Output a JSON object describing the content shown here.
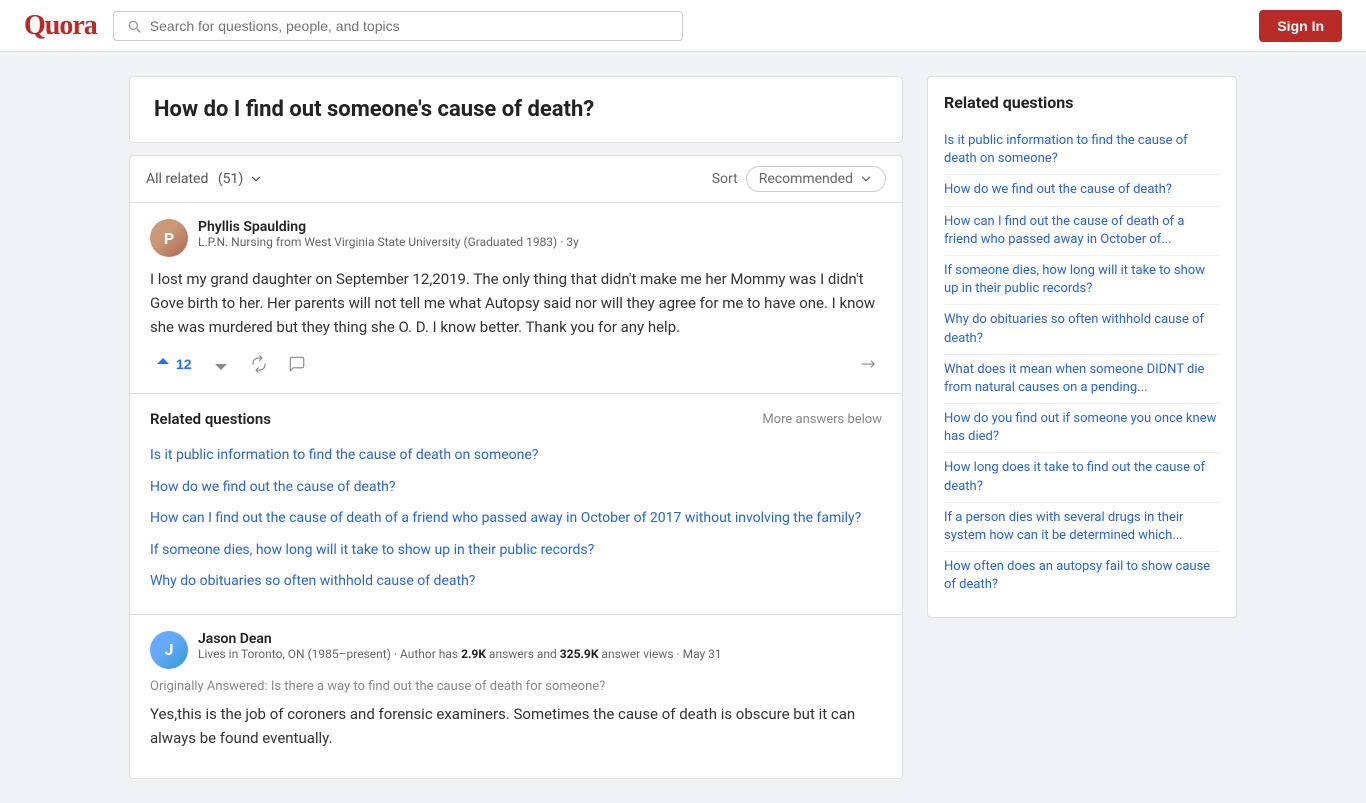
{
  "header": {
    "logo": "Quora",
    "search_placeholder": "Search for questions, people, and topics",
    "sign_in_label": "Sign In"
  },
  "main": {
    "question_title": "How do I find out someone's cause of death?",
    "answers_toolbar": {
      "all_related_label": "All related",
      "count": "51",
      "sort_label": "Sort",
      "sort_selected": "Recommended"
    },
    "answers": [
      {
        "id": "phyllis",
        "author_name": "Phyllis Spaulding",
        "author_cred": "L.P.N. Nursing from West Virginia State University (Graduated 1983) · 3y",
        "avatar_initial": "P",
        "text": "I lost my grand daughter on September 12,2019. The only thing that didn't make me her Mommy was I didn't Gove birth to her. Her parents will not tell me what Autopsy said nor will they agree for me to have one. I know she was murdered but they thing she O. D. I know better. Thank you for any help.",
        "upvote_count": "12"
      }
    ],
    "related_inline": {
      "title": "Related questions",
      "more_label": "More answers below",
      "links": [
        "Is it public information to find the cause of death on someone?",
        "How do we find out the cause of death?",
        "How can I find out the cause of death of a friend who passed away in October of 2017 without involving the family?",
        "If someone dies, how long will it take to show up in their public records?",
        "Why do obituaries so often withhold cause of death?"
      ]
    },
    "second_answer": {
      "author_name": "Jason Dean",
      "author_cred": "Lives in Toronto, ON (1985–present) · Author has",
      "author_cred2": "2.9K",
      "author_cred3": "answers and",
      "author_cred4": "325.9K",
      "author_cred5": "answer views · May 31",
      "avatar_initial": "J",
      "originally_answered": "Originally Answered: Is there a way to find out the cause of death for someone?",
      "text": "Yes,this is the job of coroners and forensic examiners. Sometimes the cause of death is obscure but it can always be found eventually."
    }
  },
  "sidebar": {
    "title": "Related questions",
    "links": [
      "Is it public information to find the cause of death on someone?",
      "How do we find out the cause of death?",
      "How can I find out the cause of death of a friend who passed away in October of...",
      "If someone dies, how long will it take to show up in their public records?",
      "Why do obituaries so often withhold cause of death?",
      "What does it mean when someone DIDNT die from natural causes on a pending...",
      "How do you find out if someone you once knew has died?",
      "How long does it take to find out the cause of death?",
      "If a person dies with several drugs in their system how can it be determined which...",
      "How often does an autopsy fail to show cause of death?"
    ]
  }
}
